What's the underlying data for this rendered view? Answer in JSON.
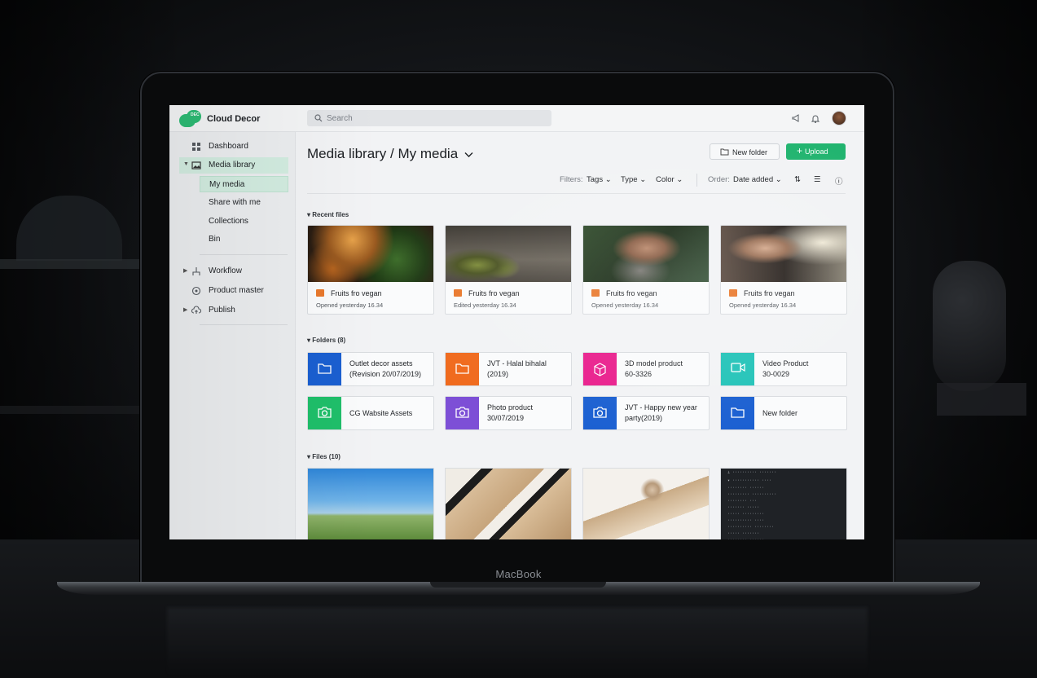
{
  "app": {
    "name": "Cloud Decor",
    "logo_tag": "DEC"
  },
  "search": {
    "placeholder": "Search"
  },
  "device": {
    "brand": "MacBook"
  },
  "sidebar": {
    "items": [
      {
        "label": "Dashboard",
        "icon": "grid-icon"
      },
      {
        "label": "Media library",
        "icon": "image-folder-icon"
      },
      {
        "label": "Workflow",
        "icon": "flow-icon"
      },
      {
        "label": "Product master",
        "icon": "box-icon"
      },
      {
        "label": "Publish",
        "icon": "cloud-upload-icon"
      }
    ],
    "subitems": [
      "My media",
      "Share with me",
      "Collections",
      "Bin"
    ]
  },
  "header": {
    "title": "Media library / My media",
    "new_folder": "New folder",
    "upload": "Upload"
  },
  "filters": {
    "label": "Filters:",
    "tags": "Tags",
    "type": "Type",
    "color": "Color",
    "order_label": "Order:",
    "order_value": "Date added"
  },
  "sections": {
    "recent": "Recent files",
    "folders": "Folders (8)",
    "files": "Files (10)"
  },
  "recent_files": [
    {
      "name": "Fruits fro vegan",
      "meta": "Opened yesterday 16.34"
    },
    {
      "name": "Fruits fro vegan",
      "meta": "Edited yesterday 16.34"
    },
    {
      "name": "Fruits fro vegan",
      "meta": "Opened yesterday 16.34"
    },
    {
      "name": "Fruits fro vegan",
      "meta": "Opened yesterday 16.34"
    }
  ],
  "folders": [
    {
      "line1": "Outlet decor assets",
      "line2": "(Revision 20/07/2019)",
      "color": "#1a5fd1",
      "icon": "folder-icon"
    },
    {
      "line1": "JVT - Halal bihalal",
      "line2": "(2019)",
      "color": "#f06a1d",
      "icon": "folder-icon"
    },
    {
      "line1": "3D model product",
      "line2": "60-3326",
      "color": "#e91e8c",
      "icon": "cube-icon"
    },
    {
      "line1": "Video Product",
      "line2": "30-0029",
      "color": "#22c3b8",
      "icon": "video-icon"
    },
    {
      "line1": "CG Wabsite Assets",
      "line2": "",
      "color": "#1fbf6a",
      "icon": "camera-icon"
    },
    {
      "line1": "Photo product",
      "line2": "30/07/2019",
      "color": "#7d4fd6",
      "icon": "camera-icon"
    },
    {
      "line1": "JVT - Happy new year",
      "line2": "party(2019)",
      "color": "#1a5fd1",
      "icon": "camera-icon"
    },
    {
      "line1": "New folder",
      "line2": "",
      "color": "#1a5fd1",
      "icon": "folder-icon"
    }
  ]
}
